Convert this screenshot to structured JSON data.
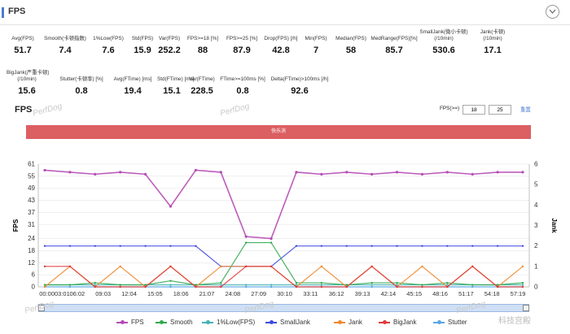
{
  "header": {
    "title": "FPS"
  },
  "metrics_row1": [
    {
      "label": "Avg(FPS)",
      "value": "51.7"
    },
    {
      "label": "Smooth(卡顿指数)",
      "value": "7.4"
    },
    {
      "label": "1%Low(FPS)",
      "value": "7.6"
    },
    {
      "label": "Std(FPS)",
      "value": "15.9"
    },
    {
      "label": "Var(FPS)",
      "value": "252.2"
    },
    {
      "label": "FPS>=18 [%]",
      "value": "88"
    },
    {
      "label": "FPS>=25 [%]",
      "value": "87.9"
    },
    {
      "label": "Drop(FPS) [/h]",
      "value": "42.8"
    },
    {
      "label": "Min(FPS)",
      "value": "7"
    },
    {
      "label": "Median(FPS)",
      "value": "58"
    },
    {
      "label": "MedRange(FPS)[%]",
      "value": "85.7"
    },
    {
      "label": "SmallJank(微小卡顿)\n(/10min)",
      "value": "530.6"
    },
    {
      "label": "Jank(卡顿)\n(/10min)",
      "value": "17.1"
    }
  ],
  "metrics_row2": [
    {
      "label": "BigJank(严重卡顿)\n(/10min)",
      "value": "15.6"
    },
    {
      "label": "Stutter(卡顿率) [%]",
      "value": "0.8"
    },
    {
      "label": "Avg(FTime) [ms]",
      "value": "19.4"
    },
    {
      "label": "Std(FTime) [ms]",
      "value": "15.1"
    },
    {
      "label": "Var(FTime)",
      "value": "228.5"
    },
    {
      "label": "FTime>=100ms [%]",
      "value": "0.8"
    },
    {
      "label": "Delta(FTime)>100ms [/h]",
      "value": "92.6"
    }
  ],
  "chart_section": {
    "title": "FPS",
    "filter_label": "FPS(>=)",
    "filter_low": "18",
    "filter_high": "25",
    "reset_label": "重置",
    "banner_text": "快乐消",
    "watermark": "PerfDog",
    "brand": "科技宫殿"
  },
  "chart_data": {
    "type": "line",
    "title": "",
    "xlabel": "",
    "ylabel": "FPS",
    "y2label": "Jank",
    "ylim": [
      0,
      61
    ],
    "y2lim": [
      0,
      6
    ],
    "yticks": [
      0,
      6,
      12,
      18,
      24,
      31,
      37,
      43,
      49,
      55,
      61
    ],
    "y2ticks": [
      0,
      1,
      2,
      3,
      4,
      5,
      6
    ],
    "categories": [
      "00:00",
      "03:01",
      "06:02",
      "09:03",
      "12:04",
      "15:05",
      "18:06",
      "21:07",
      "24:08",
      "27:09",
      "30:10",
      "33:11",
      "36:12",
      "39:13",
      "42:14",
      "45:15",
      "48:16",
      "51:17",
      "54:18",
      "57:19"
    ],
    "x_tick_labels": [
      "00:0003:01",
      "06:02",
      "09:03",
      "12:04",
      "15:05",
      "18:06",
      "21:07",
      "24:08",
      "27:09",
      "30:10",
      "33:11",
      "36:12",
      "39:13",
      "42:14",
      "45:15",
      "48:16",
      "51:17",
      "54:18",
      "57:19"
    ],
    "series": [
      {
        "name": "FPS",
        "color": "#b54bb5",
        "values": [
          58,
          57,
          56,
          57,
          56,
          40,
          58,
          57,
          25,
          24,
          57,
          56,
          57,
          56,
          57,
          56,
          57,
          56,
          57,
          57
        ]
      },
      {
        "name": "Smooth",
        "color": "#33a84f",
        "values": [
          1,
          1,
          2,
          1,
          1,
          3,
          1,
          2,
          22,
          22,
          2,
          2,
          1,
          2,
          2,
          1,
          2,
          1,
          1,
          2
        ]
      },
      {
        "name": "1%Low(FPS)",
        "color": "#45b3b3",
        "values": [
          1,
          1,
          1,
          1,
          1,
          1,
          1,
          1,
          1,
          1,
          1,
          1,
          1,
          1,
          1,
          1,
          1,
          1,
          1,
          1
        ]
      },
      {
        "name": "SmallJank",
        "color": "#3f4ae0",
        "values": [
          2,
          2,
          2,
          2,
          2,
          2,
          2,
          1,
          1,
          1,
          2,
          2,
          2,
          2,
          2,
          2,
          2,
          2,
          2,
          2
        ]
      },
      {
        "name": "Jank",
        "color": "#f08a30",
        "values": [
          0,
          1,
          0,
          1,
          0,
          1,
          0,
          1,
          1,
          1,
          0,
          1,
          0,
          1,
          0,
          1,
          0,
          1,
          0,
          1
        ]
      },
      {
        "name": "BigJank",
        "color": "#e03b3b",
        "values": [
          1,
          1,
          0,
          0,
          0,
          1,
          0,
          0,
          1,
          1,
          0,
          0,
          0,
          1,
          0,
          0,
          0,
          1,
          0,
          0
        ]
      },
      {
        "name": "Stutter",
        "color": "#5aa7e6",
        "values": [
          0,
          0,
          0,
          0,
          0,
          0,
          0,
          0,
          0,
          0,
          0,
          0,
          0,
          0,
          0,
          0,
          0,
          0,
          0,
          0
        ]
      }
    ],
    "legend_position": "bottom",
    "grid": true
  }
}
